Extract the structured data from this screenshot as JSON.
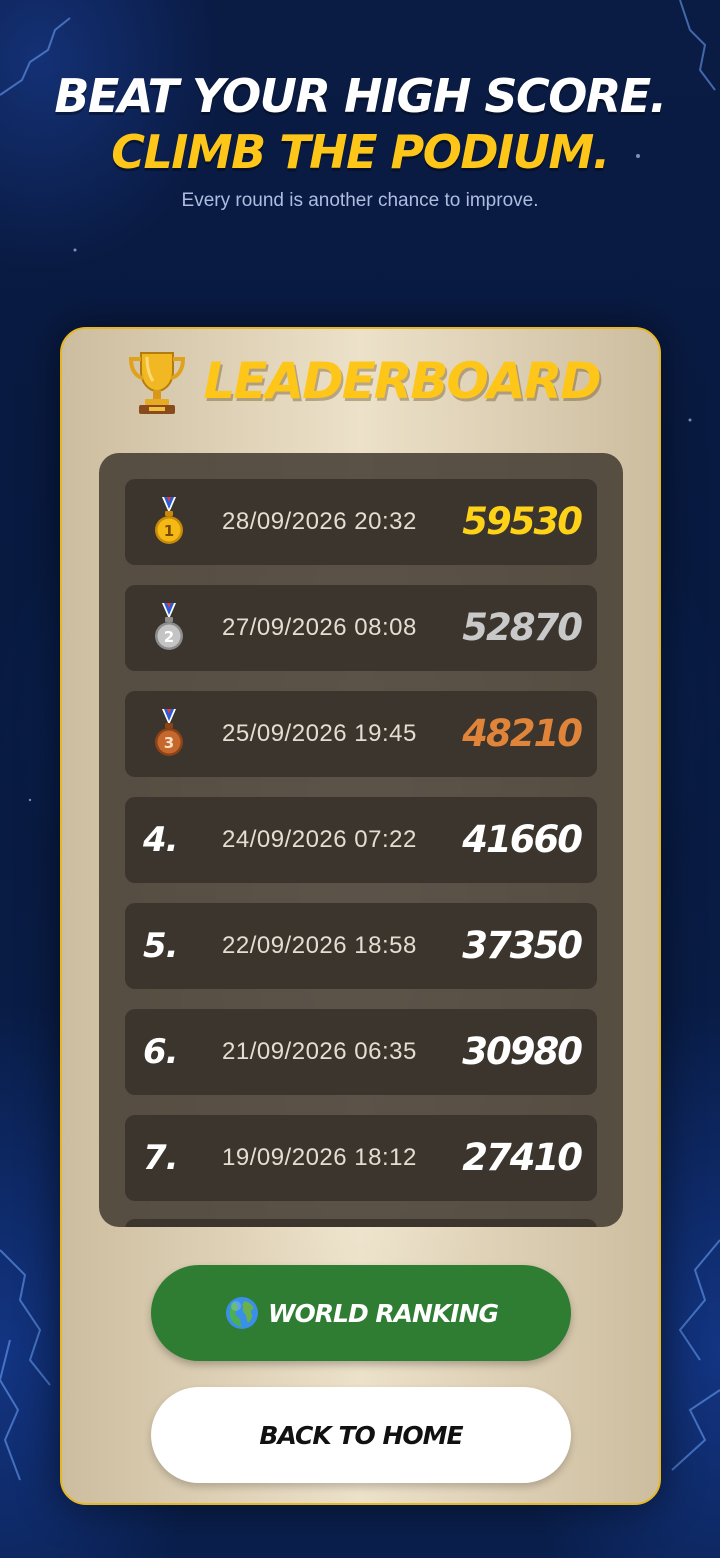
{
  "hero": {
    "line1": "BEAT YOUR HIGH SCORE.",
    "line2": "CLIMB THE PODIUM.",
    "subtitle": "Every round is another chance to improve."
  },
  "leaderboard": {
    "title": "LEADERBOARD",
    "title_icon": "trophy-icon",
    "entries": [
      {
        "rank": "1",
        "medal": "gold-medal-icon",
        "date": "28/09/2026 20:32",
        "score": "59530",
        "score_color": "#ffd21a"
      },
      {
        "rank": "2",
        "medal": "silver-medal-icon",
        "date": "27/09/2026 08:08",
        "score": "52870",
        "score_color": "#c9c9c9"
      },
      {
        "rank": "3",
        "medal": "bronze-medal-icon",
        "date": "25/09/2026 19:45",
        "score": "48210",
        "score_color": "#e0843a"
      },
      {
        "rank": "4.",
        "date": "24/09/2026 07:22",
        "score": "41660",
        "score_color": "#ffffff"
      },
      {
        "rank": "5.",
        "date": "22/09/2026 18:58",
        "score": "37350",
        "score_color": "#ffffff"
      },
      {
        "rank": "6.",
        "date": "21/09/2026 06:35",
        "score": "30980",
        "score_color": "#ffffff"
      },
      {
        "rank": "7.",
        "date": "19/09/2026 18:12",
        "score": "27410",
        "score_color": "#ffffff"
      }
    ]
  },
  "buttons": {
    "world_ranking_label": "WORLD RANKING",
    "world_ranking_icon": "globe-icon",
    "back_home_label": "BACK TO HOME"
  },
  "colors": {
    "accent_yellow": "#ffc61a",
    "button_green": "#2e7d32",
    "background_navy": "#0a1b44"
  }
}
